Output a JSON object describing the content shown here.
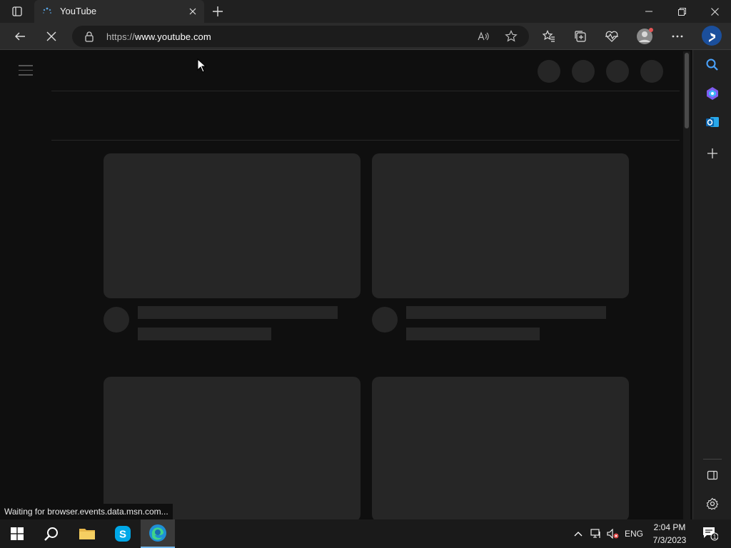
{
  "browser": {
    "tab_title": "YouTube",
    "url_prefix": "https://",
    "url_host": "www.youtube.com",
    "status_text": "Waiting for browser.events.data.msn.com..."
  },
  "icons": {
    "tab_actions": "tab-actions-icon",
    "favicon": "loading-spinner-icon",
    "tab_close": "close-icon",
    "new_tab": "plus-icon",
    "minimize": "minimize-icon",
    "restore": "restore-icon",
    "close_window": "close-icon",
    "back": "back-arrow-icon",
    "stop": "stop-loading-icon",
    "lock": "lock-icon",
    "read_aloud": "read-aloud-icon",
    "favorite": "star-icon",
    "favorites": "favorites-icon",
    "collections": "collections-icon",
    "performance": "heart-pulse-icon",
    "profile": "profile-avatar-icon",
    "more": "more-options-icon",
    "copilot": "bing-copilot-icon",
    "search": "search-icon",
    "shopping": "edge-shopping-icon",
    "outlook": "outlook-icon",
    "add": "plus-icon",
    "split": "sidebar-toggle-icon",
    "settings": "gear-icon"
  },
  "taskbar": {
    "language": "ENG",
    "time": "2:04 PM",
    "date": "7/3/2023",
    "notification_count": "1"
  },
  "colors": {
    "page_bg": "#0f0f0f",
    "placeholder": "#262626",
    "accent": "#76b9ed"
  }
}
